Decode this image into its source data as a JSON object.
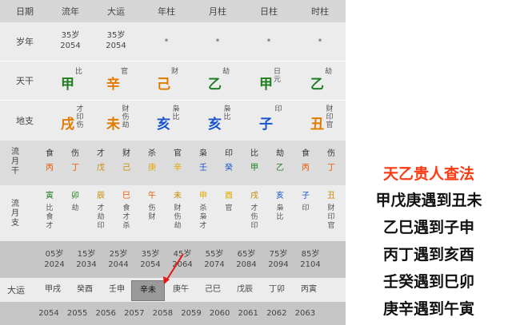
{
  "header": {
    "label": "日期",
    "cols": [
      "流年",
      "大运",
      "年柱",
      "月柱",
      "日柱",
      "时柱"
    ]
  },
  "ages": {
    "label": "岁年",
    "liunian": [
      "35岁",
      "2054"
    ],
    "dayun": [
      "35岁",
      "2054"
    ],
    "star": "*"
  },
  "tiangan": {
    "label": "天干",
    "cells": [
      {
        "char": "甲",
        "sup": "比",
        "color": "#1e7d1e"
      },
      {
        "char": "辛",
        "sup": "官",
        "color": "#e07b00"
      },
      {
        "char": "己",
        "sup": "财",
        "color": "#e07b00"
      },
      {
        "char": "乙",
        "sup": "劫",
        "color": "#1e7d1e"
      },
      {
        "char": "甲",
        "sup": "日元",
        "color": "#1e7d1e"
      },
      {
        "char": "乙",
        "sup": "劫",
        "color": "#1e7d1e"
      }
    ]
  },
  "dizhi": {
    "label": "地支",
    "cells": [
      {
        "char": "戌",
        "sub": "才印伤",
        "color": "#e07b00"
      },
      {
        "char": "未",
        "sub": "财伤劫",
        "color": "#e07b00"
      },
      {
        "char": "亥",
        "sub": "枭比",
        "color": "#1a55cc"
      },
      {
        "char": "亥",
        "sub": "枭比",
        "color": "#1a55cc"
      },
      {
        "char": "子",
        "sub": "印",
        "color": "#1a55cc"
      },
      {
        "char": "丑",
        "sub": "财印官",
        "color": "#e07b00"
      }
    ]
  },
  "liuyue_gan": {
    "label": "流月干",
    "items": [
      {
        "top": "食",
        "bot": "丙",
        "color": "#e85a00"
      },
      {
        "top": "伤",
        "bot": "丁",
        "color": "#e85a00"
      },
      {
        "top": "才",
        "bot": "戊",
        "color": "#c88a00"
      },
      {
        "top": "财",
        "bot": "己",
        "color": "#c88a00"
      },
      {
        "top": "杀",
        "bot": "庚",
        "color": "#e0a800"
      },
      {
        "top": "官",
        "bot": "辛",
        "color": "#e0a800"
      },
      {
        "top": "枭",
        "bot": "壬",
        "color": "#1a55cc"
      },
      {
        "top": "印",
        "bot": "癸",
        "color": "#1a55cc"
      },
      {
        "top": "比",
        "bot": "甲",
        "color": "#1e7d1e"
      },
      {
        "top": "劫",
        "bot": "乙",
        "color": "#1e7d1e"
      },
      {
        "top": "食",
        "bot": "丙",
        "color": "#e85a00"
      },
      {
        "top": "伤",
        "bot": "丁",
        "color": "#e85a00"
      }
    ]
  },
  "liuyue_zhi": {
    "label": "流月支",
    "items": [
      {
        "top": "寅",
        "sub": "比食才",
        "color": "#1e7d1e"
      },
      {
        "top": "卯",
        "sub": "劫",
        "color": "#1e7d1e"
      },
      {
        "top": "辰",
        "sub": "才劫印",
        "color": "#c88a00"
      },
      {
        "top": "巳",
        "sub": "食才杀",
        "color": "#e85a00"
      },
      {
        "top": "午",
        "sub": "伤财",
        "color": "#e85a00"
      },
      {
        "top": "未",
        "sub": "财伤劫",
        "color": "#c88a00"
      },
      {
        "top": "申",
        "sub": "杀枭才",
        "color": "#e0a800"
      },
      {
        "top": "酉",
        "sub": "官",
        "color": "#e0a800"
      },
      {
        "top": "戌",
        "sub": "才伤印",
        "color": "#c88a00"
      },
      {
        "top": "亥",
        "sub": "枭比",
        "color": "#1a55cc"
      },
      {
        "top": "子",
        "sub": "印",
        "color": "#1a55cc"
      },
      {
        "top": "丑",
        "sub": "财印官",
        "color": "#c88a00"
      }
    ]
  },
  "dayun_ages": [
    [
      "05岁",
      "2024"
    ],
    [
      "15岁",
      "2034"
    ],
    [
      "25岁",
      "2044"
    ],
    [
      "35岁",
      "2054"
    ],
    [
      "45岁",
      "2064"
    ],
    [
      "55岁",
      "2074"
    ],
    [
      "65岁",
      "2084"
    ],
    [
      "75岁",
      "2094"
    ],
    [
      "85岁",
      "2104"
    ]
  ],
  "dayun": {
    "label": "大运",
    "items": [
      "甲戌",
      "癸酉",
      "壬申",
      "辛未",
      "庚午",
      "己巳",
      "戊辰",
      "丁卯",
      "丙寅"
    ],
    "selected_index": 3
  },
  "years": [
    "2054",
    "2055",
    "2056",
    "2057",
    "2058",
    "2059",
    "2060",
    "2061",
    "2062",
    "2063"
  ],
  "rules": {
    "title": "天乙贵人查法",
    "lines": [
      "甲戊庚遇到丑未",
      "乙巳遇到子申",
      "丙丁遇到亥酉",
      "壬癸遇到巳卯",
      "庚辛遇到午寅"
    ]
  },
  "colors": {
    "title_red": "#ff3a12",
    "gray_light": "#ececec",
    "gray_mid": "#dadada",
    "gray_dark": "#bfbfbf",
    "arrow": "#e01818"
  }
}
